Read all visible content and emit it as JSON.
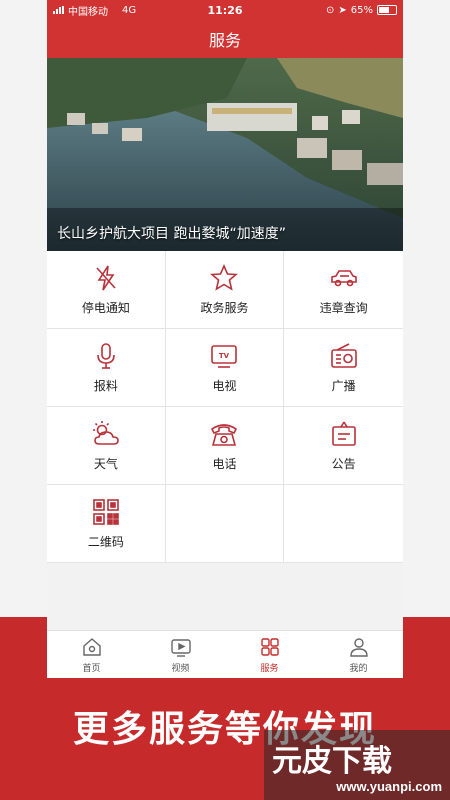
{
  "colors": {
    "brand_red": "#d13333",
    "page_red": "#c62a2a",
    "icon_red": "#b8323a"
  },
  "status_bar": {
    "carrier": "中国移动",
    "network": "4G",
    "time": "11:26",
    "battery": "65%"
  },
  "header": {
    "title": "服务"
  },
  "banner": {
    "caption": "长山乡护航大项目 跑出婺城“加速度”"
  },
  "services": [
    {
      "label": "停电通知",
      "icon": "lightning-off-icon"
    },
    {
      "label": "政务服务",
      "icon": "star-icon"
    },
    {
      "label": "违章查询",
      "icon": "car-icon"
    },
    {
      "label": "报料",
      "icon": "microphone-icon"
    },
    {
      "label": "电视",
      "icon": "tv-icon"
    },
    {
      "label": "广播",
      "icon": "radio-icon"
    },
    {
      "label": "天气",
      "icon": "weather-icon"
    },
    {
      "label": "电话",
      "icon": "telephone-icon"
    },
    {
      "label": "公告",
      "icon": "notice-icon"
    },
    {
      "label": "二维码",
      "icon": "qrcode-icon"
    }
  ],
  "tabs": [
    {
      "label": "首页",
      "icon": "home-icon",
      "active": false
    },
    {
      "label": "视频",
      "icon": "video-icon",
      "active": false
    },
    {
      "label": "服务",
      "icon": "grid-icon",
      "active": true
    },
    {
      "label": "我的",
      "icon": "user-icon",
      "active": false
    }
  ],
  "slogan": "更多服务等你发现",
  "watermark": {
    "brand": "元皮下载",
    "url": "www.yuanpi.com"
  }
}
